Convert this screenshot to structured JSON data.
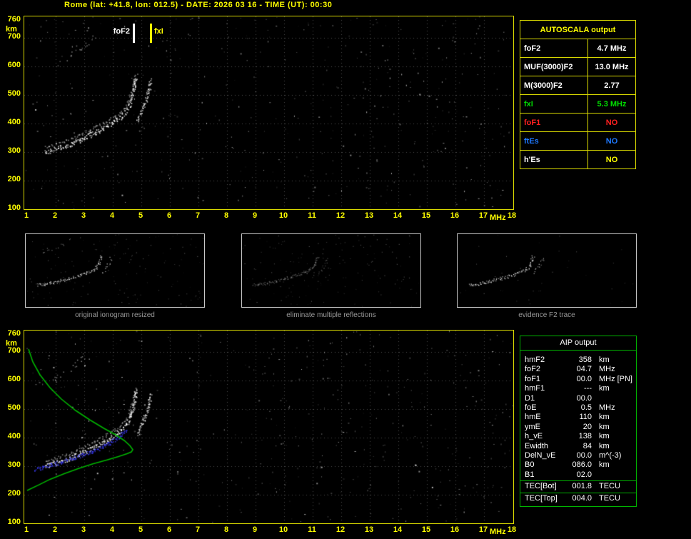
{
  "header": {
    "title": "Rome (lat: +41.8, lon: 012.5) - DATE: 2026 03 16 - TIME (UT): 00:30"
  },
  "axes": {
    "y_unit": "km",
    "x_unit": "MHz",
    "y_ticks": [
      "760",
      "700",
      "600",
      "500",
      "400",
      "300",
      "200",
      "100"
    ],
    "x_ticks": [
      "1",
      "2",
      "3",
      "4",
      "5",
      "6",
      "7",
      "8",
      "9",
      "10",
      "11",
      "12",
      "13",
      "14",
      "15",
      "16",
      "17",
      "18"
    ]
  },
  "markers": {
    "foF2_label": "foF2",
    "fxI_label": "fxI",
    "foF2_mhz": 4.7,
    "fxI_mhz": 5.3
  },
  "autoscala": {
    "title": "AUTOSCALA output",
    "rows": [
      {
        "param": "foF2",
        "value": "4.7 MHz",
        "color": "#ffffff"
      },
      {
        "param": "MUF(3000)F2",
        "value": "13.0 MHz",
        "color": "#ffffff"
      },
      {
        "param": "M(3000)F2",
        "value": "2.77",
        "color": "#ffffff"
      },
      {
        "param": "fxI",
        "value": "5.3 MHz",
        "color": "#00dd00"
      },
      {
        "param": "foF1",
        "value": "NO",
        "color": "#ff2020"
      },
      {
        "param": "ftEs",
        "value": "NO",
        "color": "#1e78ff"
      },
      {
        "param": "h'Es",
        "value": "NO",
        "color": "#ffffff",
        "value_color": "#ffff00"
      }
    ]
  },
  "thumbnails": [
    {
      "caption": "original ionogram resized"
    },
    {
      "caption": "eliminate multiple reflections"
    },
    {
      "caption": "evidence F2 trace"
    }
  ],
  "aip": {
    "title": "AIP output",
    "rows": [
      {
        "param": "hmF2",
        "value": "358",
        "unit": "km"
      },
      {
        "param": "foF2",
        "value": "04.7",
        "unit": "MHz"
      },
      {
        "param": "foF1",
        "value": "00.0",
        "unit": "MHz",
        "note": "[PN]"
      },
      {
        "param": "hmF1",
        "value": "---",
        "unit": "km"
      },
      {
        "param": "D1",
        "value": "00.0",
        "unit": ""
      },
      {
        "param": "foE",
        "value": "0.5",
        "unit": "MHz"
      },
      {
        "param": "hmE",
        "value": "110",
        "unit": "km"
      },
      {
        "param": "ymE",
        "value": "20",
        "unit": "km"
      },
      {
        "param": "h_vE",
        "value": "138",
        "unit": "km"
      },
      {
        "param": "Ewidth",
        "value": "84",
        "unit": "km"
      },
      {
        "param": "DelN_vE",
        "value": "00.0",
        "unit": "m^(-3)"
      },
      {
        "param": "B0",
        "value": "086.0",
        "unit": "km"
      },
      {
        "param": "B1",
        "value": "02.0",
        "unit": ""
      },
      {
        "param": "TEC[Bot]",
        "value": "001.8",
        "unit": "TECU",
        "boxed": true
      },
      {
        "param": "TEC[Top]",
        "value": "004.0",
        "unit": "TECU",
        "boxed": true
      }
    ]
  },
  "chart_data": {
    "type": "scatter",
    "title": "ionogram",
    "xlabel": "MHz",
    "ylabel": "km",
    "xlim": [
      1,
      18
    ],
    "ylim": [
      100,
      760
    ],
    "grid": true,
    "series": [
      {
        "name": "F2 ordinary trace",
        "color": "#ffffff",
        "x": [
          1.6,
          1.8,
          2.0,
          2.2,
          2.5,
          2.8,
          3.1,
          3.4,
          3.7,
          4.0,
          4.2,
          4.4,
          4.55,
          4.65,
          4.72,
          4.78,
          4.82
        ],
        "y": [
          303,
          306,
          312,
          318,
          328,
          342,
          357,
          372,
          388,
          405,
          420,
          438,
          460,
          490,
          520,
          550,
          565
        ]
      },
      {
        "name": "F2 extraordinary trace",
        "color": "#ffffff",
        "x": [
          4.85,
          4.95,
          5.05,
          5.15,
          5.22,
          5.28,
          5.32
        ],
        "y": [
          415,
          435,
          458,
          482,
          508,
          532,
          558
        ]
      },
      {
        "name": "multiple reflection trace",
        "color": "#aaaaaa",
        "x": [
          1.9,
          2.2,
          2.6,
          3.0,
          3.3
        ],
        "y": [
          600,
          622,
          650,
          680,
          700
        ]
      },
      {
        "name": "autoscala restored trace",
        "color": "#3030ff",
        "x": [
          1.25,
          1.6,
          2.0,
          2.5,
          3.0,
          3.5,
          4.0,
          4.3,
          4.5
        ],
        "y": [
          288,
          300,
          310,
          326,
          342,
          362,
          390,
          412,
          430
        ]
      },
      {
        "name": "electron density profile",
        "color": "#00b400",
        "x": [
          1.05,
          1.2,
          1.45,
          1.8,
          2.2,
          2.7,
          3.2,
          3.7,
          4.1,
          4.4,
          4.6,
          4.7,
          4.65,
          4.5,
          4.2,
          3.8,
          3.3,
          2.8,
          2.3,
          1.8,
          1.4,
          1.0
        ],
        "y": [
          710,
          665,
          620,
          575,
          535,
          495,
          462,
          432,
          410,
          390,
          372,
          358,
          350,
          344,
          334,
          322,
          308,
          292,
          274,
          254,
          234,
          215
        ]
      }
    ]
  }
}
